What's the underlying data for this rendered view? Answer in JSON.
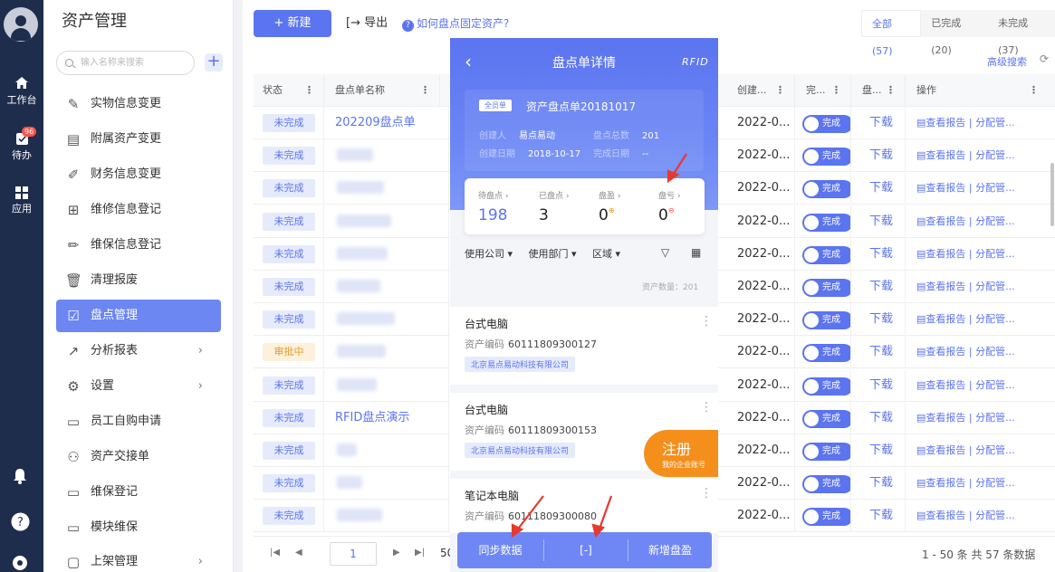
{
  "rail": {
    "items": [
      {
        "label": "工作台",
        "icon": "home-icon"
      },
      {
        "label": "待办",
        "icon": "todo-icon",
        "badge": "96"
      },
      {
        "label": "应用",
        "icon": "apps-icon"
      }
    ]
  },
  "sidebar": {
    "title": "资产管理",
    "search_placeholder": "输入名称来搜索",
    "items": [
      {
        "label": "实物信息变更",
        "icon": "edit-icon"
      },
      {
        "label": "附属资产变更",
        "icon": "document-icon"
      },
      {
        "label": "财务信息变更",
        "icon": "pen-icon"
      },
      {
        "label": "维修信息登记",
        "icon": "file-plus-icon"
      },
      {
        "label": "维保信息登记",
        "icon": "pencil-icon"
      },
      {
        "label": "清理报废",
        "icon": "trash-icon"
      },
      {
        "label": "盘点管理",
        "icon": "checkbox-icon",
        "active": true
      },
      {
        "label": "分析报表",
        "icon": "trend-icon",
        "submenu": true
      },
      {
        "label": "设置",
        "icon": "gear-icon",
        "submenu": true
      },
      {
        "label": "员工自购申请",
        "icon": "monitor-icon"
      },
      {
        "label": "资产交接单",
        "icon": "user-plus-icon"
      },
      {
        "label": "维保登记",
        "icon": "monitor-icon"
      },
      {
        "label": "模块维保",
        "icon": "monitor-icon"
      },
      {
        "label": "上架管理",
        "icon": "folder-icon",
        "submenu": true
      }
    ]
  },
  "toolbar": {
    "new_label": "+ 新建",
    "export_label": "导出",
    "help_label": "如何盘点固定资产?"
  },
  "tabs": [
    {
      "label": "全部 (57)",
      "active": true
    },
    {
      "label": "已完成 (20)"
    },
    {
      "label": "未完成 (37)"
    }
  ],
  "advanced_search": "高级搜索",
  "table": {
    "columns": [
      "状态",
      "盘点单名称",
      "创建...",
      "完...",
      "盘...",
      "操作"
    ],
    "rows": [
      {
        "status": "未完成",
        "name": "202209盘点单",
        "date": "2022-0...",
        "toggle": "完成",
        "dl": "下载",
        "ops": "查看报告 | 分配管..."
      },
      {
        "status": "未完成",
        "name": "",
        "date": "2022-0...",
        "toggle": "完成",
        "dl": "下载",
        "ops": "查看报告 | 分配管..."
      },
      {
        "status": "未完成",
        "name": "",
        "date": "2022-0...",
        "toggle": "完成",
        "dl": "下载",
        "ops": "查看报告 | 分配管..."
      },
      {
        "status": "未完成",
        "name": "",
        "date": "2022-0...",
        "toggle": "完成",
        "dl": "下载",
        "ops": "查看报告 | 分配管..."
      },
      {
        "status": "未完成",
        "name": "",
        "date": "2022-0...",
        "toggle": "完成",
        "dl": "下载",
        "ops": "查看报告 | 分配管..."
      },
      {
        "status": "未完成",
        "name": "",
        "date": "2022-0...",
        "toggle": "完成",
        "dl": "下载",
        "ops": "查看报告 | 分配管..."
      },
      {
        "status": "未完成",
        "name": "",
        "date": "2022-0...",
        "toggle": "完成",
        "dl": "下载",
        "ops": "查看报告 | 分配管..."
      },
      {
        "status": "审批中",
        "name": "",
        "date": "2022-0...",
        "toggle": "完成",
        "dl": "下载",
        "ops": "查看报告 | 分配管...",
        "review": true
      },
      {
        "status": "未完成",
        "name": "",
        "date": "2022-0...",
        "toggle": "完成",
        "dl": "下载",
        "ops": "查看报告 | 分配管..."
      },
      {
        "status": "未完成",
        "name": "RFID盘点演示",
        "date": "2022-0...",
        "toggle": "完成",
        "dl": "下载",
        "ops": "查看报告 | 分配管..."
      },
      {
        "status": "未完成",
        "name": "",
        "date": "2022-0...",
        "toggle": "完成",
        "dl": "下载",
        "ops": "查看报告 | 分配管..."
      },
      {
        "status": "未完成",
        "name": "",
        "date": "2022-0...",
        "toggle": "完成",
        "dl": "下载",
        "ops": "查看报告 | 分配管..."
      },
      {
        "status": "未完成",
        "name": "",
        "date": "2022-0...",
        "toggle": "完成",
        "dl": "下载",
        "ops": "查看报告 | 分配管..."
      }
    ]
  },
  "pager": {
    "page": "1",
    "size": "50",
    "summary": "1 - 50 条   共 57 条数据"
  },
  "phone": {
    "title": "盘点单详情",
    "rfid": "RFID",
    "tag": "全员单",
    "name": "资产盘点单20181017",
    "creator_label": "创建人",
    "creator": "易点易动",
    "total_label": "盘点总数",
    "total": "201",
    "date_label": "创建日期",
    "date": "2018-10-17",
    "done_label": "完成日期",
    "done": "--",
    "stats": [
      {
        "label": "待盘点 ›",
        "value": "198"
      },
      {
        "label": "已盘点 ›",
        "value": "3"
      },
      {
        "label": "盘盈 ›",
        "value": "0"
      },
      {
        "label": "盘亏 ›",
        "value": "0"
      }
    ],
    "filters": [
      "使用公司 ▾",
      "使用部门 ▾",
      "区域 ▾"
    ],
    "count": "资产数量：201",
    "cards": [
      {
        "title": "台式电脑",
        "code_label": "资产编码",
        "code": "60111809300127",
        "org": "北京易点易动科技有限公司"
      },
      {
        "title": "台式电脑",
        "code_label": "资产编码",
        "code": "60111809300153",
        "org": "北京易点易动科技有限公司"
      },
      {
        "title": "笔记本电脑",
        "code_label": "资产编码",
        "code": "60111809300080",
        "org": ""
      }
    ],
    "register": "注册",
    "register_sub": "我的企业账号",
    "bottom": {
      "sync": "同步数据",
      "scan": "[-]",
      "add": "新增盘盈"
    }
  }
}
